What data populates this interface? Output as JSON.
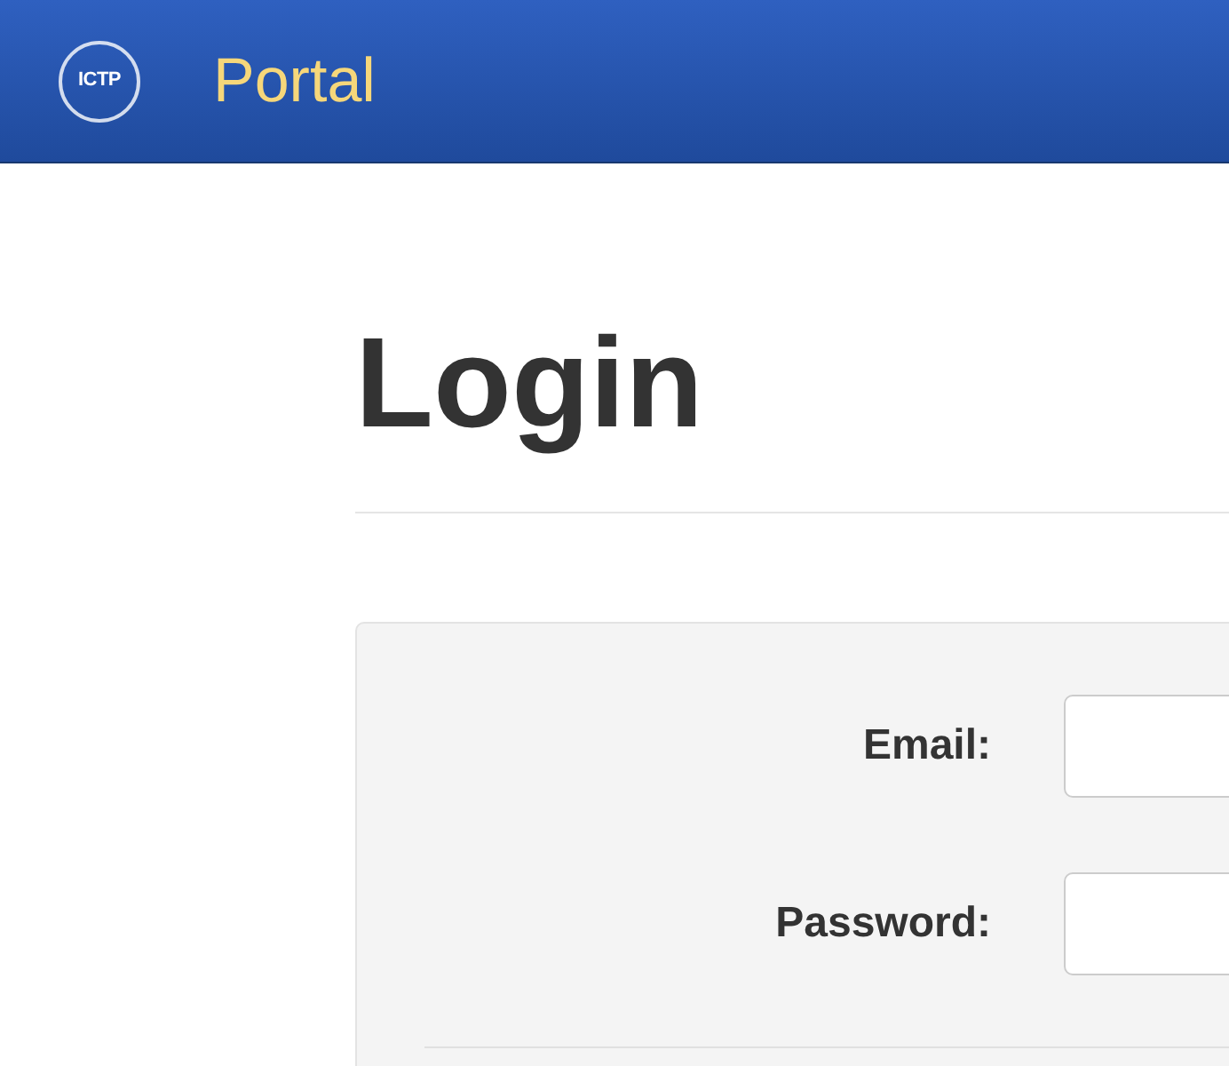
{
  "header": {
    "logo_text": "ICTP",
    "title": "Portal"
  },
  "heading": "Login",
  "form": {
    "fields": [
      {
        "label": "Email:"
      },
      {
        "label": "Password:"
      }
    ]
  }
}
